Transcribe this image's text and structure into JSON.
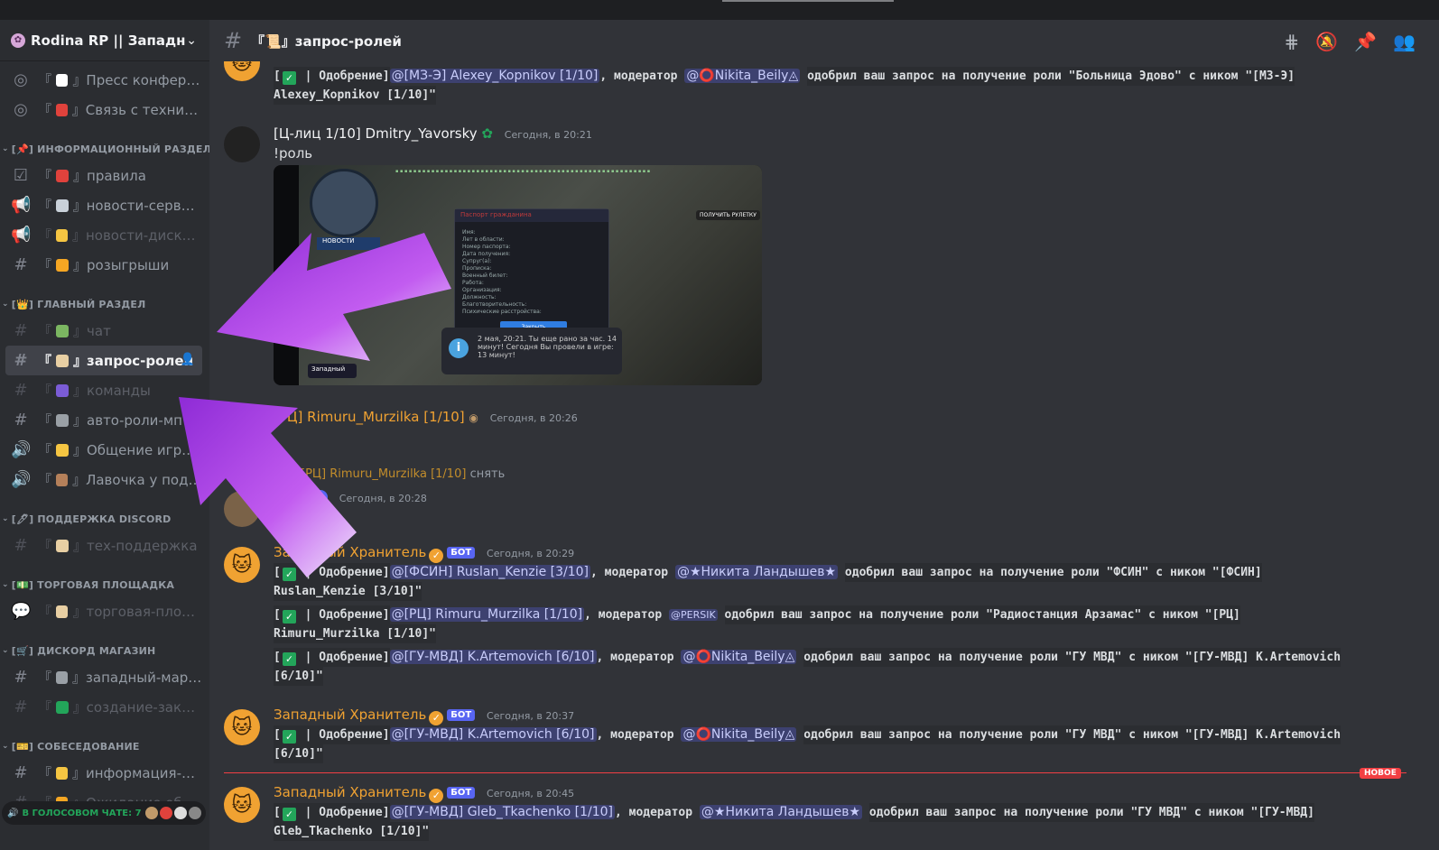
{
  "server": {
    "name": "Rodina RP || Западн...",
    "icon": "server-icon"
  },
  "sidebar": {
    "items": [
      {
        "type": "channel",
        "icon": "stage-icon",
        "emoji_color": "#ffffff",
        "label": "Пресс конфере...",
        "muted": false
      },
      {
        "type": "channel",
        "icon": "stage-icon",
        "emoji_color": "#e0423c",
        "label": "Связь с техниче...",
        "muted": false
      },
      {
        "type": "category",
        "label": "[📌] ИНФОРМАЦИОННЫЙ РАЗДЕЛ"
      },
      {
        "type": "channel",
        "icon": "rules-icon",
        "emoji_color": "#e0423c",
        "label": "правила",
        "muted": false
      },
      {
        "type": "channel",
        "icon": "announce-icon",
        "emoji_color": "#c9d1d9",
        "label": "новости-сервера",
        "muted": false
      },
      {
        "type": "channel",
        "icon": "announce-icon",
        "emoji_color": "#f5c542",
        "label": "новости-дискор...",
        "muted": true
      },
      {
        "type": "channel",
        "icon": "hash-icon",
        "emoji_color": "#f5a623",
        "label": "розыгрыши",
        "muted": false
      },
      {
        "type": "category",
        "label": "[👑] ГЛАВНЫЙ РАЗДЕЛ"
      },
      {
        "type": "channel",
        "icon": "hash-icon",
        "emoji_color": "#7bb661",
        "label": "чат",
        "muted": true
      },
      {
        "type": "channel",
        "icon": "hash-icon",
        "emoji_color": "#e8cfa3",
        "label": "запрос-ролей",
        "muted": false,
        "active": true
      },
      {
        "type": "channel",
        "icon": "hash-icon",
        "emoji_color": "#7b5cd6",
        "label": "команды",
        "muted": true
      },
      {
        "type": "channel",
        "icon": "hash-icon",
        "emoji_color": "#9aa0a6",
        "label": "авто-роли-мп",
        "muted": false
      },
      {
        "type": "channel",
        "icon": "speaker-icon",
        "emoji_color": "#f5c542",
        "label": "Общение игро...",
        "muted": false
      },
      {
        "type": "channel",
        "icon": "speaker-icon",
        "emoji_color": "#b5805a",
        "label": "Лавочка у подъ...",
        "muted": false
      },
      {
        "type": "category",
        "label": "[🖊] ПОДДЕРЖКА DISCORD"
      },
      {
        "type": "channel",
        "icon": "hash-icon",
        "emoji_color": "#e8cfa3",
        "label": "тех-поддержка",
        "muted": true
      },
      {
        "type": "category",
        "label": "[💵] ТОРГОВАЯ ПЛОЩАДКА"
      },
      {
        "type": "channel",
        "icon": "forum-icon",
        "emoji_color": "#e8cfa3",
        "label": "торговая-площ...",
        "muted": true
      },
      {
        "type": "category",
        "label": "[🛒] ДИСКОРД МАГАЗИН"
      },
      {
        "type": "channel",
        "icon": "hash-icon",
        "emoji_color": "#9aa0a6",
        "label": "западный-маркет",
        "muted": false
      },
      {
        "type": "channel",
        "icon": "hash-icon",
        "emoji_color": "#23a55a",
        "label": "создание-заказа",
        "muted": true
      },
      {
        "type": "category",
        "label": "[🎫] СОБЕСЕДОВАНИЕ"
      },
      {
        "type": "channel",
        "icon": "hash-icon",
        "emoji_color": "#f5c542",
        "label": "информация-по...",
        "muted": false
      },
      {
        "type": "channel",
        "icon": "hash-icon",
        "emoji_color": "#f5a623",
        "label": "Ожидание обсл...",
        "muted": true
      }
    ],
    "voice_bar": "В ГОЛОСОВОМ ЧАТЕ: 7"
  },
  "header": {
    "channel": "『📜』запрос-ролей"
  },
  "messages": {
    "m0": {
      "label": "| Одобрение]",
      "mention1": "@[МЗ-Э] Alexey_Kopnikov [1/10]",
      "mod_label": ", модератор",
      "mention2": "@⭕Nikita_Beily◬",
      "text1": "одобрил ваш запрос на получение роли \"Больница Эдово\" с ником \"[МЗ-Э]",
      "text2": "Alexey_Kopnikov [1/10]\""
    },
    "m1": {
      "author": "[Ц-лиц 1/10] Dmitry_Yavorsky",
      "time": "Сегодня, в 20:21",
      "text": "!роль"
    },
    "screenshot": {
      "tag": "НОВОСТИ",
      "panel_title": "Паспорт гражданина",
      "fields": [
        "Имя:",
        "Лет в области:",
        "Номер паспорта:",
        "Дата получения:",
        "Супруг(а):",
        "Прописка:",
        "Военный билет:",
        "Работа:",
        "Организация:",
        "Должность:",
        "Благотворительность:",
        "Психические расстройства:"
      ],
      "button": "Закрыть",
      "notice": "2 мая, 20:21. Ты еще рано за час. 14 минут! Сегодня Вы провели в игре: 13 минут!",
      "brand": "Западный",
      "roulette": "ПОЛУЧИТЬ РУЛЕТКУ"
    },
    "m2": {
      "author": "[РЦ] Rimuru_Murzilka [1/10]",
      "time": "Сегодня, в 20:26",
      "text": ""
    },
    "m3": {
      "reply_name": "@[РЦ] Rimuru_Murzilka [1/10]",
      "reply_text": "снять",
      "time": "Сегодня, в 20:28"
    },
    "m4": {
      "author": "Западный Хранитель",
      "bot": "БОТ",
      "time": "Сегодня, в 20:29",
      "l1_label": "| Одобрение]",
      "l1_m1": "@[ФСИН] Ruslan_Kenzie [3/10]",
      "l1_mod": ", модератор",
      "l1_m2": "@★Никита Ландышев★",
      "l1_t1": "одобрил ваш запрос на получение роли \"ФСИН\" с ником \"[ФСИН]",
      "l1_t2": "Ruslan_Kenzie [3/10]\"",
      "l2_label": "| Одобрение]",
      "l2_m1": "@[РЦ] Rimuru_Murzilka [1/10]",
      "l2_mod": ", модератор",
      "l2_m2": "@PERSIK",
      "l2_t1": "одобрил ваш запрос на получение роли \"Радиостанция Арзамас\" с ником \"[РЦ]",
      "l2_t2": "Rimuru_Murzilka [1/10]\"",
      "l3_label": "| Одобрение]",
      "l3_m1": "@[ГУ-МВД] K.Artemovich [6/10]",
      "l3_mod": ", модератор",
      "l3_m2": "@⭕Nikita_Beily◬",
      "l3_t1": "одобрил ваш запрос на получение роли \"ГУ МВД\" с ником \"[ГУ-МВД] K.Artemovich",
      "l3_t2": "[6/10]\""
    },
    "m5": {
      "author": "Западный Хранитель",
      "bot": "БОТ",
      "time": "Сегодня, в 20:37",
      "label": "| Одобрение]",
      "m1": "@[ГУ-МВД] K.Artemovich [6/10]",
      "mod": ", модератор",
      "m2": "@⭕Nikita_Beily◬",
      "t1": "одобрил ваш запрос на получение роли \"ГУ МВД\" с ником \"[ГУ-МВД] K.Artemovich",
      "t2": "[6/10]\""
    },
    "new_label": "НОВОЕ",
    "m6": {
      "author": "Западный Хранитель",
      "bot": "БОТ",
      "time": "Сегодня, в 20:45",
      "label": "| Одобрение]",
      "m1": "@[ГУ-МВД] Gleb_Tkachenko [1/10]",
      "mod": ", модератор",
      "m2": "@★Никита Ландышев★",
      "t1": "одобрил ваш запрос на получение роли \"ГУ МВД\" с ником \"[ГУ-МВД]",
      "t2": "Gleb_Tkachenko [1/10]\""
    }
  },
  "colors": {
    "accent": "#5865f2",
    "bot_name": "#f0a232",
    "arrow": "#b64be8",
    "new_line": "#f23f43"
  }
}
